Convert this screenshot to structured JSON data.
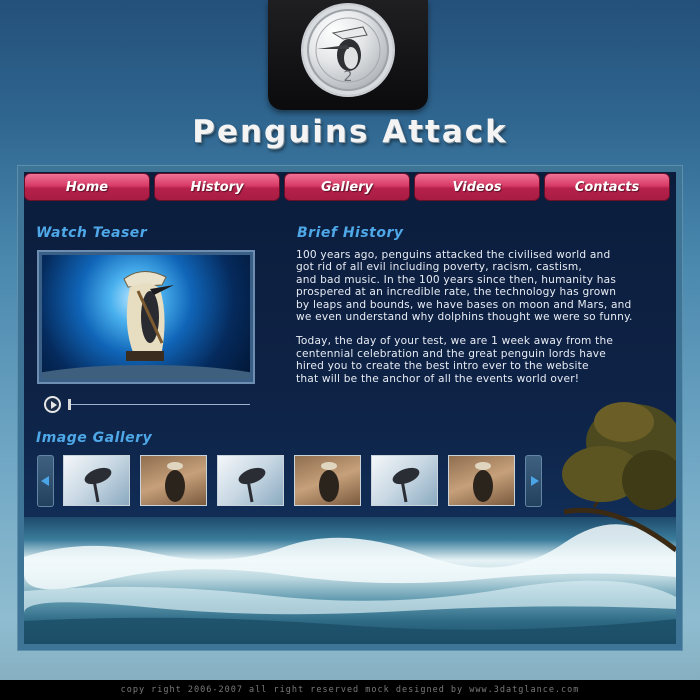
{
  "site": {
    "title": "Penguins Attack"
  },
  "logo": {
    "icon": "penguin-coin-icon"
  },
  "nav": {
    "items": [
      {
        "label": "Home"
      },
      {
        "label": "History"
      },
      {
        "label": "Gallery"
      },
      {
        "label": "Videos"
      },
      {
        "label": "Contacts"
      }
    ]
  },
  "teaser": {
    "heading": "Watch Teaser"
  },
  "history": {
    "heading": "Brief History",
    "paragraph1": "100 years ago, penguins attacked the civilised world and\ngot rid of all evil including poverty, racism, castism,\nand bad music. In the 100 years since then, humanity has\nprospered at an incredible rate, the technology has grown\nby leaps and bounds, we have bases on moon and Mars, and\nwe even understand why dolphins thought we were so funny.",
    "paragraph2": "Today, the day of your test, we are 1 week away from the\ncentennial celebration and the great penguin lords have\nhired you to create the best intro ever to the website\nthat will be the anchor of all the events world over!"
  },
  "gallery": {
    "heading": "Image Gallery"
  },
  "footer": {
    "text": "copy right 2006-2007 all right reserved mock designed by www.3datglance.com"
  },
  "colors": {
    "nav_button": "#c8305a",
    "heading": "#4ea8e8",
    "panel_bg": "#0e2347",
    "page_bg": "#2f6690"
  }
}
